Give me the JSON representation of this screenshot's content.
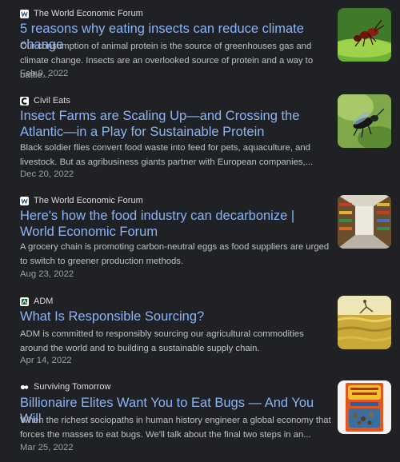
{
  "articles": [
    {
      "source": "The World Economic Forum",
      "source_icon": "wef-logo-icon",
      "title": "5 reasons why eating insects can reduce climate change",
      "snippet": "Our consumption of animal protein is the source of greenhouses gas and climate change. Insects are an overlooked source of protein and a way to battle...",
      "date": "Feb 9, 2022",
      "thumbnail": "ant-on-leaf-image"
    },
    {
      "source": "Civil Eats",
      "source_icon": "civil-eats-logo-icon",
      "title": "Insect Farms are Scaling Up—and Crossing the Atlantic—in a Play for Sustainable Protein",
      "snippet": "Black soldier flies convert food waste into feed for pets, aquaculture, and livestock. But as agribusiness giants partner with European companies,...",
      "date": "Dec 20, 2022",
      "thumbnail": "black-soldier-fly-image"
    },
    {
      "source": "The World Economic Forum",
      "source_icon": "wef-logo-icon",
      "title": "Here's how the food industry can decarbonize | World Economic Forum",
      "snippet": "A grocery chain is promoting carbon-neutral eggs as food suppliers are urged to switch to greener production methods.",
      "date": "Aug 23, 2022",
      "thumbnail": "grocery-aisle-image"
    },
    {
      "source": "ADM",
      "source_icon": "adm-logo-icon",
      "title": "What Is Responsible Sourcing?",
      "snippet": "ADM is committed to responsibly sourcing our agricultural commodities around the world and to building a sustainable supply chain.",
      "date": "Apr 14, 2022",
      "thumbnail": "wheat-field-image"
    },
    {
      "source": "Surviving Tomorrow",
      "source_icon": "surviving-tomorrow-logo-icon",
      "title": "Billionaire Elites Want You to Eat Bugs — And You Will",
      "snippet": "When the richest sociopaths in human history engineer a global economy that forces the masses to eat bugs. We'll talk about the final two steps in an...",
      "date": "Mar 25, 2022",
      "thumbnail": "uncle-ikes-bugs-box-image"
    }
  ],
  "colors": {
    "background": "#202124",
    "title_link": "#8ab4f8",
    "snippet_text": "#bdc1c6",
    "date_text": "#9aa0a6"
  }
}
